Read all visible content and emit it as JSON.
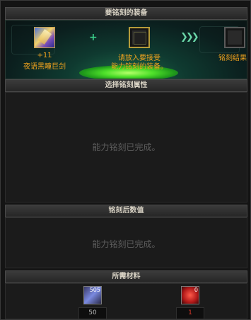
{
  "sections": {
    "equip_header": "要铭刻的装备",
    "attr_header": "选择铭刻属性",
    "value_header": "铭刻后数值",
    "material_header": "所需材料"
  },
  "equip": {
    "item_level": "+11",
    "item_name": "夜语黑瞳巨剑",
    "prompt_line1": "请放入要接受",
    "prompt_line2": "能力铭刻的装备。",
    "result_label": "铭刻结果"
  },
  "attr_message": "能力铭刻已完成。",
  "value_message": "能力铭刻已完成。",
  "materials": [
    {
      "icon": "crystal-shard-icon",
      "stack": "505",
      "count": "50",
      "count_color": "#b8b8b8"
    },
    {
      "icon": "red-gem-icon",
      "stack": "0",
      "count": "1",
      "count_color": "#e03a2a"
    }
  ]
}
